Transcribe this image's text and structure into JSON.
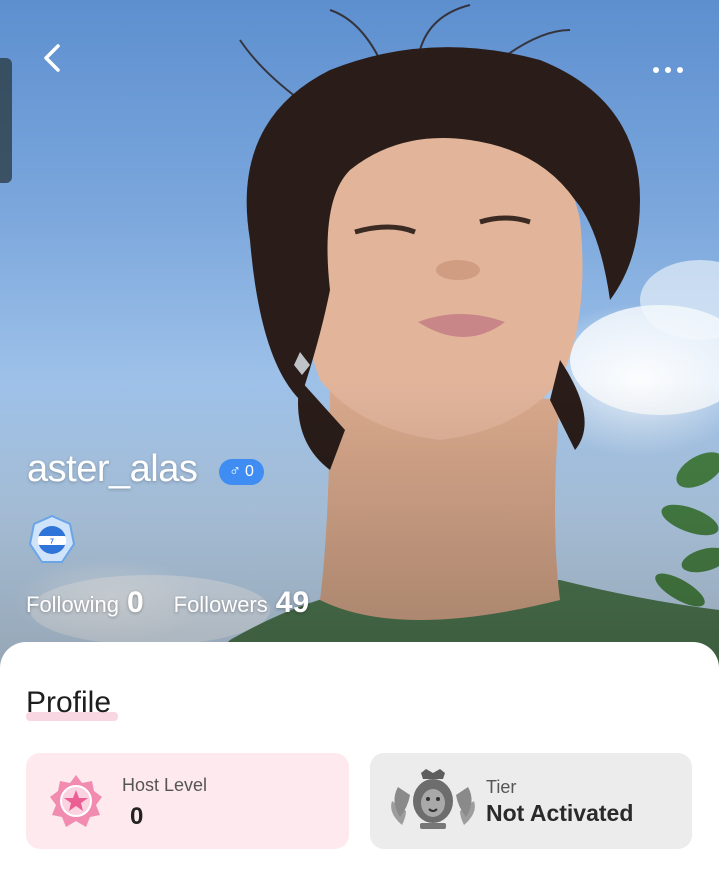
{
  "header": {
    "back_icon": "chevron-left-icon",
    "more_icon": "more-horizontal-icon"
  },
  "user": {
    "username": "aster_alas",
    "gender_symbol": "♂",
    "gender_count": "0",
    "badge_icon": "level-badge-icon"
  },
  "stats": {
    "following_label": "Following",
    "following_value": "0",
    "followers_label": "Followers",
    "followers_value": "49"
  },
  "profile": {
    "heading": "Profile",
    "host_level": {
      "label": "Host Level",
      "value": "0",
      "icon": "pink-star-badge-icon"
    },
    "tier": {
      "label": "Tier",
      "value": "Not Activated",
      "icon": "lion-crest-icon"
    }
  },
  "colors": {
    "gender_badge": "#3f8df2",
    "host_tile": "#fde9ee",
    "tier_tile": "#ececec",
    "heading_underline": "#f9d7e2"
  }
}
